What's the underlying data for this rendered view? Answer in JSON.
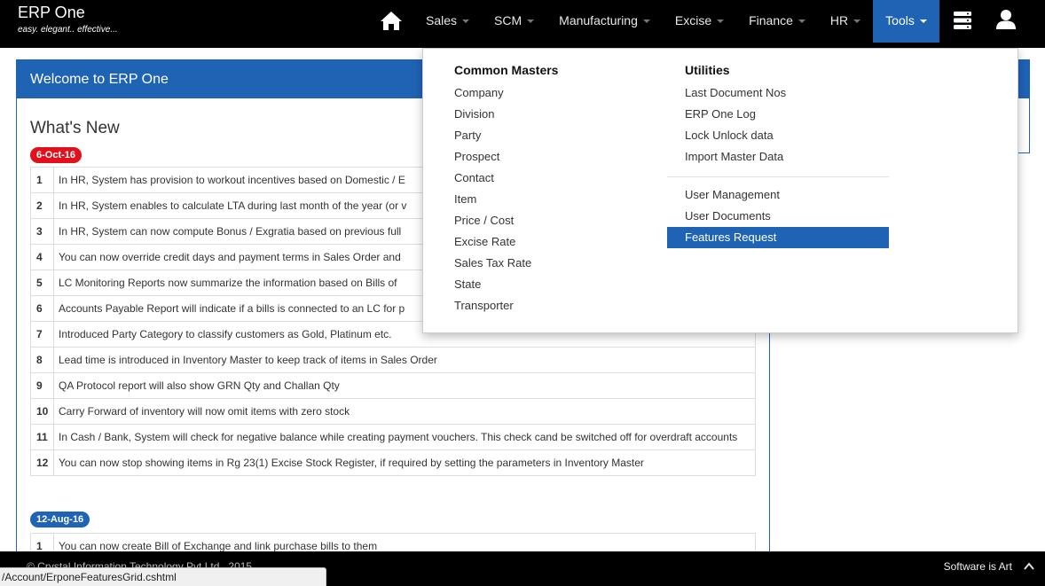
{
  "brand": {
    "name": "ERP One",
    "tagline": "easy. elegant.. effective..."
  },
  "nav": {
    "items": [
      {
        "label": "Sales"
      },
      {
        "label": "SCM"
      },
      {
        "label": "Manufacturing"
      },
      {
        "label": "Excise"
      },
      {
        "label": "Finance"
      },
      {
        "label": "HR"
      },
      {
        "label": "Tools"
      }
    ],
    "active": "Tools",
    "icons": [
      "home-icon",
      "server-icon",
      "user-icon"
    ]
  },
  "panel": {
    "title": "Welcome to ERP One",
    "whats_new": "What's New",
    "groups": [
      {
        "date": "6-Oct-16",
        "rows": [
          {
            "n": "1",
            "text": "In HR, System has provision to workout incentives based on Domestic / E"
          },
          {
            "n": "2",
            "text": "In HR, System enables to calculate LTA during last month of the year (or v"
          },
          {
            "n": "3",
            "text": "In HR, System can now compute Bonus / Exgratia based on previous full"
          },
          {
            "n": "4",
            "text": "You can now override credit days and payment terms in Sales Order and"
          },
          {
            "n": "5",
            "text": "LC Monitoring Reports now summarize the information based on Bills of"
          },
          {
            "n": "6",
            "text": "Accounts Payable Report will indicate if a bills is connected to an LC for p"
          },
          {
            "n": "7",
            "text": "Introduced Party Category to classify customers as Gold, Platinum etc."
          },
          {
            "n": "8",
            "text": "Lead time is introduced in Inventory Master to keep track of items in Sales Order"
          },
          {
            "n": "9",
            "text": "QA Protocol report will also show GRN Qty and Challan Qty"
          },
          {
            "n": "10",
            "text": "Carry Forward of inventory will now omit items with zero stock"
          },
          {
            "n": "11",
            "text": "In Cash / Bank, System will check for negative balance while creating payment vouchers. This check cand be switched off for overdraft accounts"
          },
          {
            "n": "12",
            "text": "You can now stop showing items in Rg 23(1) Excise Stock Register, if required by setting the parameters in Inventory Master"
          }
        ]
      },
      {
        "date": "12-Aug-16",
        "rows": [
          {
            "n": "1",
            "text": "You can now create Bill of Exchange and link purchase bills to them"
          }
        ]
      }
    ]
  },
  "dropdown": {
    "common_masters": {
      "heading": "Common Masters",
      "items": [
        "Company",
        "Division",
        "Party",
        "Prospect",
        "Contact",
        "Item",
        "Price / Cost",
        "Excise Rate",
        "Sales Tax Rate",
        "State",
        "Transporter"
      ]
    },
    "utilities": {
      "heading": "Utilities",
      "items_a": [
        "Last Document Nos",
        "ERP One Log",
        "Lock Unlock data",
        "Import Master Data"
      ],
      "items_b": [
        "User Management",
        "User Documents",
        "Features Request"
      ],
      "highlighted": "Features Request"
    }
  },
  "footer": {
    "copyright": "© Crystal Information Technology Pvt Ltd., 2015",
    "right_text": "Software is Art",
    "status_url": "/Account/ErponeFeaturesGrid.cshtml"
  },
  "colors": {
    "accent": "#1f63b5",
    "badge_red": "#e0101c",
    "navbar": "#000000"
  }
}
